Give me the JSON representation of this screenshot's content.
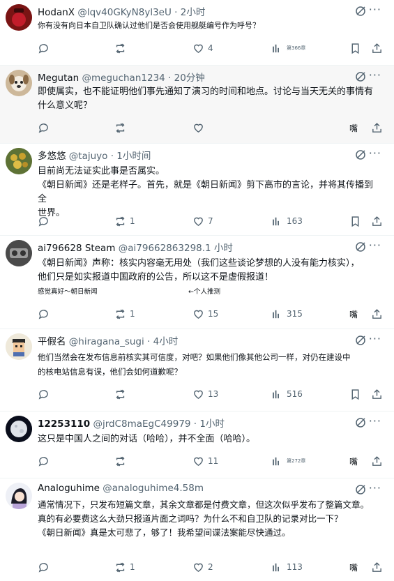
{
  "posts": [
    {
      "name": "HodanX",
      "handle": "@lqv40GKyN8yl3eU",
      "time": "· 2小时",
      "lines": [
        "你有没有向日本自卫队确认过他们是否会使用舰艇编号作为呼号？"
      ],
      "reply": "",
      "repost": "",
      "like": "4",
      "views": "第366章",
      "bookmark_label": ""
    },
    {
      "name": "Megutan",
      "handle": "@meguchan1234",
      "time": "· 20分钟",
      "lines": [
        "即使属实，也不能证明他们事先通知了演习的时间和地点。讨论与当天无关的事情有",
        "什么意义呢？"
      ],
      "reply": "",
      "repost": "",
      "like": "",
      "views": "",
      "bookmark_label": "嘴"
    },
    {
      "name": "多悠悠",
      "handle": "@tajuyo",
      "time": "· 1小时间",
      "lines": [
        "目前尚无法证实此事是否属实。",
        "《朝日新闻》还是老样子。首先，就是《朝日新闻》剪下高市的言论，并将其传播到全",
        "世界。"
      ],
      "reply": "",
      "repost": "1",
      "like": "7",
      "views": "163",
      "bookmark_label": ""
    },
    {
      "name": "ai796628 Steam",
      "handle": "@ai79662863298.1",
      "time": "小时",
      "lines": [
        "《朝日新闻》声称：核实内容毫无用处（我们这些谈论梦想的人没有能力核实），",
        "他们只是如实报道中国政府的公告，所以这不是虚假报道！"
      ],
      "note_left": "感觉真好～朝日新闻",
      "note_right": "←个人推测",
      "reply": "",
      "repost": "1",
      "like": "15",
      "views": "315",
      "bookmark_label": "嘴"
    },
    {
      "name": "平假名",
      "handle": "@hiragana_sugi",
      "time": "· 4小时",
      "lines": [
        "他们当然会在发布信息前核实其可信度，对吧？如果他们像其他公司一样，对仍在建设中",
        "的核电站信息有误，他们会如何道歉呢？"
      ],
      "reply": "",
      "repost": "",
      "like": "13",
      "views": "516",
      "bookmark_label": ""
    },
    {
      "name": "12253110",
      "handle": "@jrdC8maEgC49979",
      "time": "· 1小时",
      "lines": [
        "这只是中国人之间的对话（哈哈），并不全面（哈哈）。"
      ],
      "reply": "",
      "repost": "",
      "like": "11",
      "views": "第272章",
      "bookmark_label": "嘴"
    },
    {
      "name": "Analoguhime",
      "handle": "@analoguhime4.58m",
      "time": "",
      "lines": [
        "通常情况下，只发布短篇文章，其余文章都是付费文章，但这次似乎发布了整篇文章。",
        "真的有必要费这么大劲只报道片面之词吗？为什么不和自卫队的记录对比一下？",
        "《朝日新闻》真是太可悲了，够了！我希望间谍法案能尽快通过。"
      ],
      "reply": "",
      "repost": "1",
      "like": "2",
      "views": "113",
      "bookmark_label": "嘴"
    }
  ],
  "icons": {
    "more": "more-icon",
    "grok": "grok-icon",
    "reply": "reply-icon",
    "repost": "repost-icon",
    "like": "like-icon",
    "views": "views-icon",
    "bookmark": "bookmark-icon",
    "share": "share-icon"
  },
  "more_glyph": "···"
}
